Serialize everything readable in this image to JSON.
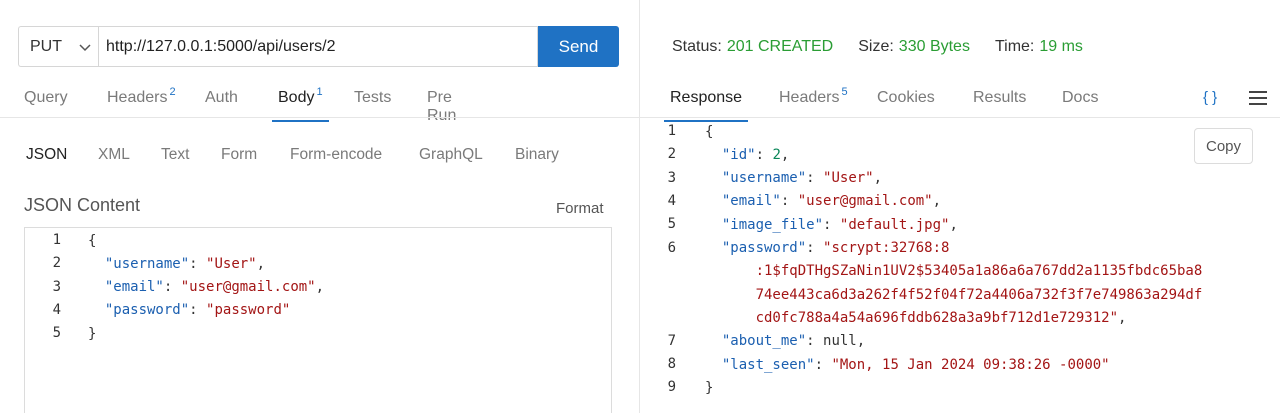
{
  "request": {
    "method": "PUT",
    "url": "http://127.0.0.1:5000/api/users/2",
    "send_label": "Send",
    "tabs": [
      {
        "label": "Query",
        "badge": ""
      },
      {
        "label": "Headers",
        "badge": "2"
      },
      {
        "label": "Auth",
        "badge": ""
      },
      {
        "label": "Body",
        "badge": "1"
      },
      {
        "label": "Tests",
        "badge": ""
      },
      {
        "label": "Pre Run",
        "badge": ""
      }
    ],
    "body_types": [
      "JSON",
      "XML",
      "Text",
      "Form",
      "Form-encode",
      "GraphQL",
      "Binary"
    ],
    "json_title": "JSON Content",
    "format_label": "Format",
    "lines": [
      {
        "n": "1",
        "text": "{"
      },
      {
        "n": "2",
        "text": "  \"username\": \"User\","
      },
      {
        "n": "3",
        "text": "  \"email\": \"user@gmail.com\","
      },
      {
        "n": "4",
        "text": "  \"password\": \"password\""
      },
      {
        "n": "5",
        "text": "}"
      }
    ]
  },
  "response": {
    "status_label": "Status:",
    "status_value": "201 CREATED",
    "size_label": "Size:",
    "size_value": "330 Bytes",
    "time_label": "Time:",
    "time_value": "19 ms",
    "tabs": [
      {
        "label": "Response",
        "badge": ""
      },
      {
        "label": "Headers",
        "badge": "5"
      },
      {
        "label": "Cookies",
        "badge": ""
      },
      {
        "label": "Results",
        "badge": ""
      },
      {
        "label": "Docs",
        "badge": ""
      }
    ],
    "braces_icon": "{ }",
    "copy_label": "Copy",
    "lines": [
      {
        "n": "1",
        "text": "{"
      },
      {
        "n": "2",
        "text": "  \"id\": 2,"
      },
      {
        "n": "3",
        "text": "  \"username\": \"User\","
      },
      {
        "n": "4",
        "text": "  \"email\": \"user@gmail.com\","
      },
      {
        "n": "5",
        "text": "  \"image_file\": \"default.jpg\","
      },
      {
        "n": "6",
        "text": "  \"password\": \"scrypt:32768:8"
      },
      {
        "n": "",
        "text": "      :1$fqDTHgSZaNin1UV2$53405a1a86a6a767dd2a1135fbdc65ba8"
      },
      {
        "n": "",
        "text": "      74ee443ca6d3a262f4f52f04f72a4406a732f3f7e749863a294df"
      },
      {
        "n": "",
        "text": "      cd0fc788a4a54a696fddb628a3a9bf712d1e729312\","
      },
      {
        "n": "7",
        "text": "  \"about_me\": null,"
      },
      {
        "n": "8",
        "text": "  \"last_seen\": \"Mon, 15 Jan 2024 09:38:26 -0000\""
      },
      {
        "n": "9",
        "text": "}"
      }
    ]
  },
  "colors": {
    "accent": "#1f72c4",
    "status_ok": "#2a9d34",
    "json_key": "#1b5fb0",
    "json_string": "#a31515",
    "json_number": "#098658"
  }
}
